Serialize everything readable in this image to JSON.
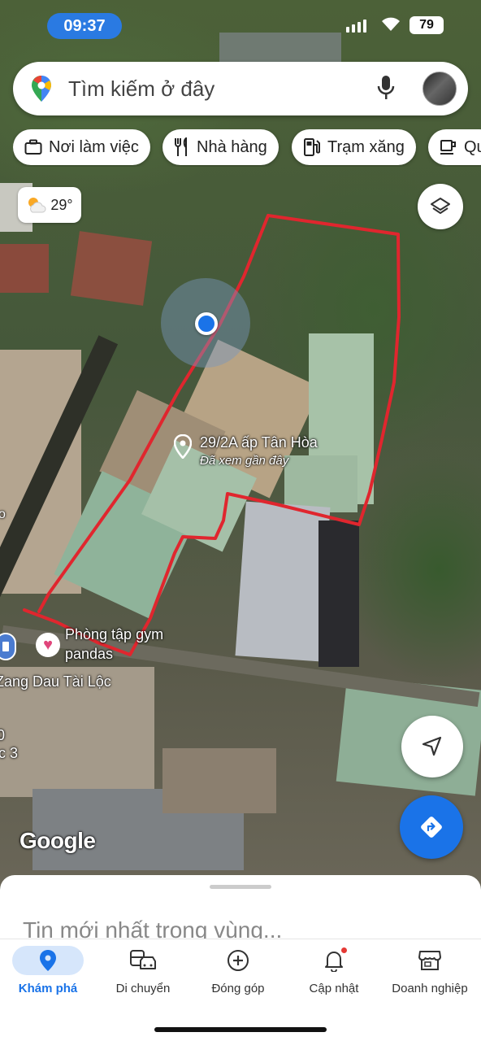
{
  "status_bar": {
    "time": "09:37",
    "battery": "79"
  },
  "search": {
    "placeholder": "Tìm kiếm ở đây"
  },
  "chips": [
    {
      "label": "Nơi làm việc",
      "icon": "briefcase-icon"
    },
    {
      "label": "Nhà hàng",
      "icon": "restaurant-icon"
    },
    {
      "label": "Trạm xăng",
      "icon": "gas-station-icon"
    },
    {
      "label": "Qu",
      "icon": "coffee-icon"
    }
  ],
  "weather": {
    "temp": "29°",
    "icon": "partly-sunny-icon"
  },
  "map": {
    "place_title": "29/2A ấp Tân Hòa",
    "place_subtitle": "Đã xem gần đây",
    "gym_name_line1": "Phòng tập gym",
    "gym_name_line2": "pandas",
    "gas_station_name": "Zang Dau Tài Lộc",
    "edge_label_1": "o",
    "edge_label_2": "0",
    "edge_label_3": "c 3",
    "attribution": "Google",
    "outline_color": "#e0262e"
  },
  "bottom_sheet": {
    "headline": "Tin mới nhất trong vùng..."
  },
  "tabs": [
    {
      "label": "Khám phá",
      "icon": "explore-pin-icon",
      "active": true
    },
    {
      "label": "Di chuyển",
      "icon": "commute-icon",
      "active": false
    },
    {
      "label": "Đóng góp",
      "icon": "contribute-icon",
      "active": false
    },
    {
      "label": "Cập nhật",
      "icon": "notification-bell-icon",
      "active": false
    },
    {
      "label": "Doanh nghiệp",
      "icon": "storefront-icon",
      "active": false
    }
  ],
  "colors": {
    "accent": "#1a73e8",
    "time_pill": "#2a7ae2",
    "badge": "#e53935"
  }
}
